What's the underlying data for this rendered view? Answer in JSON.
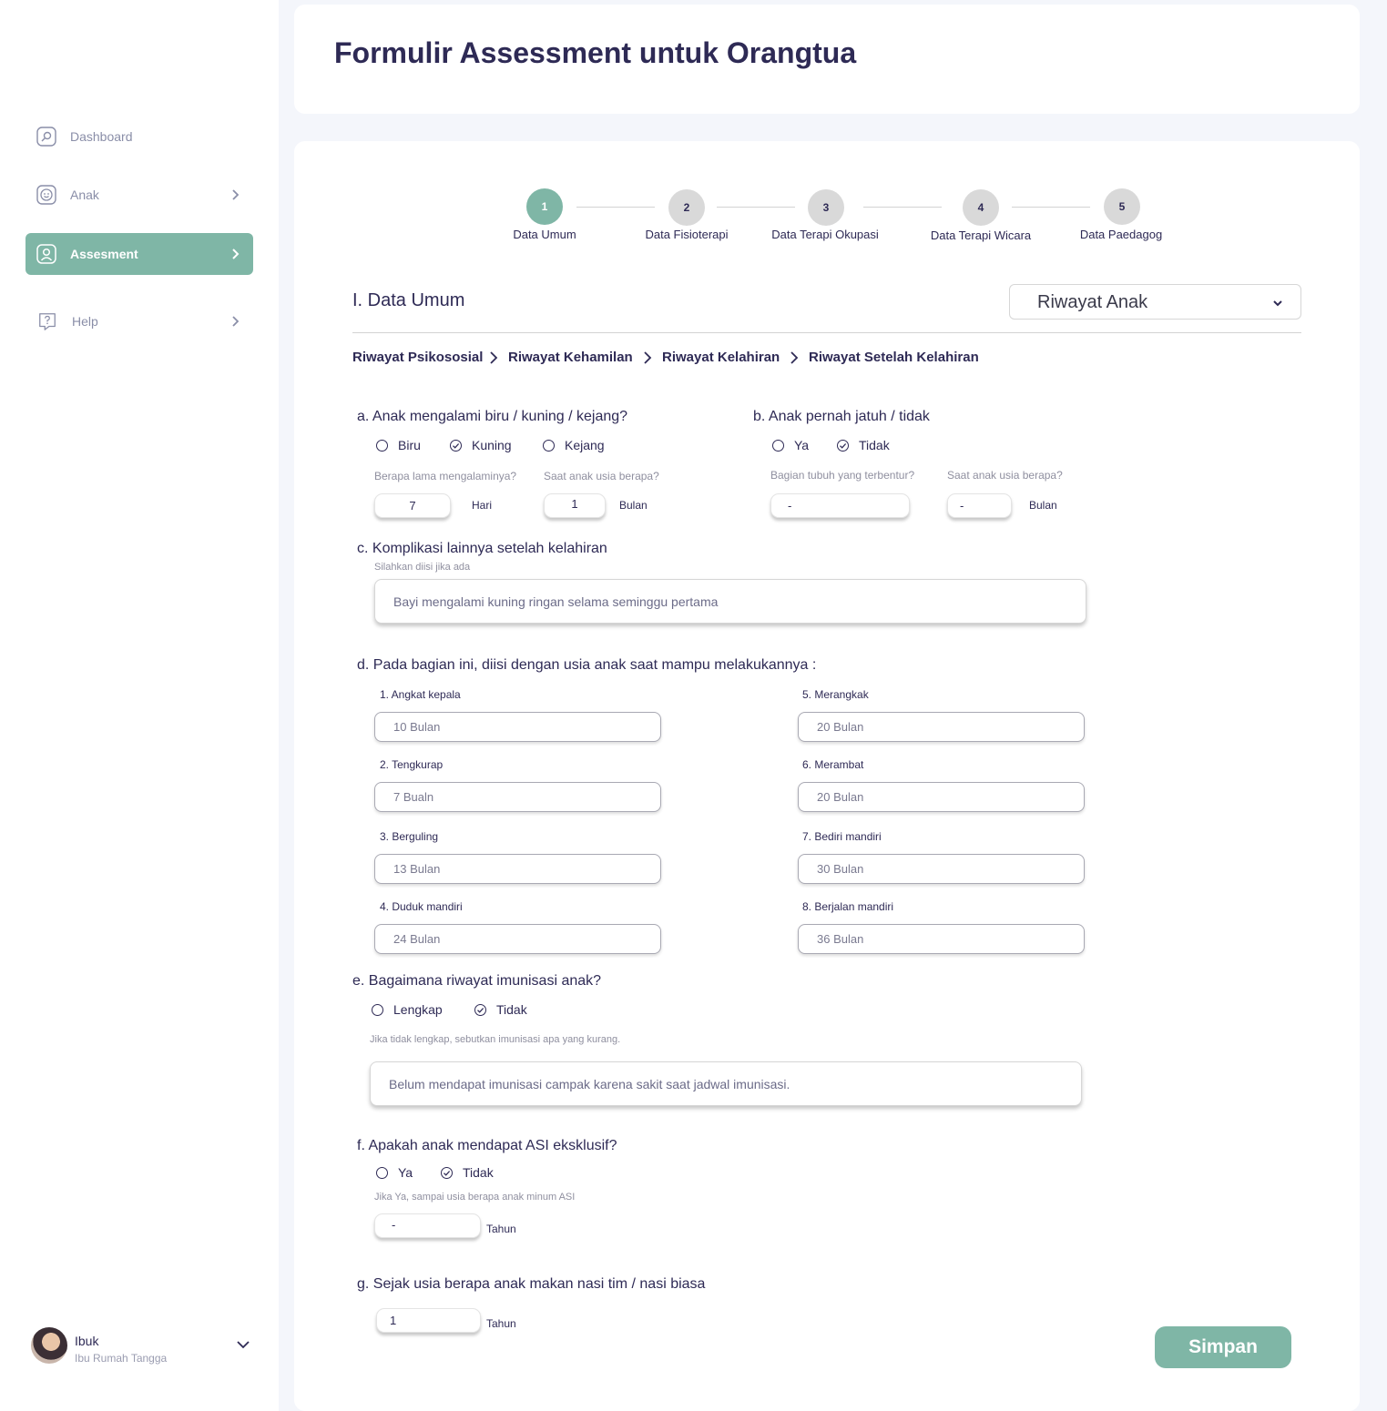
{
  "sidebar": {
    "items": [
      {
        "label": "Dashboard",
        "icon": "dashboard-icon"
      },
      {
        "label": "Anak",
        "icon": "child-face-icon"
      },
      {
        "label": "Assesment",
        "icon": "user-profile-icon"
      },
      {
        "label": "Help",
        "icon": "help-icon"
      }
    ],
    "user": {
      "name": "Ibuk",
      "role": "Ibu Rumah Tangga"
    }
  },
  "header": {
    "title": "Formulir Assessment untuk Orangtua"
  },
  "stepper": [
    {
      "number": "1",
      "label": "Data Umum",
      "active": true
    },
    {
      "number": "2",
      "label": "Data Fisioterapi",
      "active": false
    },
    {
      "number": "3",
      "label": "Data Terapi Okupasi",
      "active": false
    },
    {
      "number": "4",
      "label": "Data Terapi Wicara",
      "active": false
    },
    {
      "number": "5",
      "label": "Data Paedagog",
      "active": false
    }
  ],
  "section": {
    "title": "I. Data Umum",
    "dropdown_value": "Riwayat Anak"
  },
  "breadcrumb": [
    "Riwayat Psikososial",
    "Riwayat Kehamilan",
    "Riwayat Kelahiran",
    "Riwayat Setelah Kelahiran"
  ],
  "q_a": {
    "question": "a. Anak mengalami biru / kuning / kejang?",
    "options": [
      "Biru",
      "Kuning",
      "Kejang"
    ],
    "selected": "Kuning",
    "duration_label": "Berapa lama mengalaminya?",
    "duration_value": "7",
    "duration_unit": "Hari",
    "age_label": "Saat anak usia berapa?",
    "age_value": "1",
    "age_unit": "Bulan"
  },
  "q_b": {
    "question": "b. Anak pernah jatuh / tidak",
    "options": [
      "Ya",
      "Tidak"
    ],
    "selected": "Tidak",
    "body_label": "Bagian tubuh yang terbentur?",
    "body_value": "-",
    "age_label": "Saat anak usia berapa?",
    "age_value": "-",
    "age_unit": "Bulan"
  },
  "q_c": {
    "question": "c. Komplikasi lainnya setelah kelahiran",
    "hint": "Silahkan diisi jika ada",
    "value": "Bayi mengalami kuning ringan selama seminggu pertama"
  },
  "q_d": {
    "question": "d. Pada bagian ini, diisi dengan usia anak saat mampu melakukannya :",
    "items": [
      {
        "label": "1. Angkat kepala",
        "value": "10 Bulan"
      },
      {
        "label": "2. Tengkurap",
        "value": "7 Bualn"
      },
      {
        "label": "3. Berguling",
        "value": "13 Bulan"
      },
      {
        "label": "4. Duduk mandiri",
        "value": "24 Bulan"
      },
      {
        "label": "5. Merangkak",
        "value": "20 Bulan"
      },
      {
        "label": "6. Merambat",
        "value": "20 Bulan"
      },
      {
        "label": "7. Bediri mandiri",
        "value": "30 Bulan"
      },
      {
        "label": "8. Berjalan mandiri",
        "value": "36 Bulan"
      }
    ]
  },
  "q_e": {
    "question": "e. Bagaimana riwayat imunisasi anak?",
    "options": [
      "Lengkap",
      "Tidak"
    ],
    "selected": "Tidak",
    "hint": "Jika tidak lengkap, sebutkan imunisasi apa yang kurang.",
    "value": "Belum mendapat imunisasi campak karena sakit saat jadwal imunisasi."
  },
  "q_f": {
    "question": "f. Apakah anak mendapat ASI eksklusif?",
    "options": [
      "Ya",
      "Tidak"
    ],
    "selected": "Tidak",
    "hint": "Jika Ya, sampai usia berapa anak minum ASI",
    "value": "-",
    "unit": "Tahun"
  },
  "q_g": {
    "question": "g. Sejak usia berapa anak makan nasi tim / nasi biasa",
    "value": "1",
    "unit": "Tahun"
  },
  "actions": {
    "save_label": "Simpan"
  },
  "colors": {
    "accent": "#7fb6a6",
    "text": "#2e2a55",
    "background": "#f4f6fb"
  }
}
